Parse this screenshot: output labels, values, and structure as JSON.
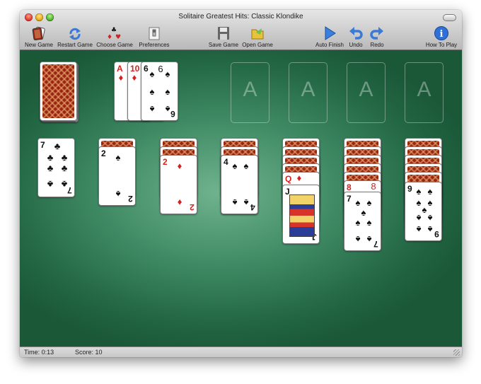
{
  "window": {
    "title": "Solitaire Greatest Hits: Classic Klondike"
  },
  "toolbar": {
    "new_game": "New Game",
    "restart_game": "Restart Game",
    "choose_game": "Choose Game",
    "preferences": "Preferences",
    "save_game": "Save Game",
    "open_game": "Open Game",
    "auto_finish": "Auto Finish",
    "undo": "Undo",
    "redo": "Redo",
    "how_to_play": "How To Play"
  },
  "foundations": {
    "labels": [
      "A",
      "A",
      "A",
      "A"
    ]
  },
  "waste": {
    "cards": [
      {
        "rank": "A",
        "suit": "♦",
        "color": "red"
      },
      {
        "rank": "10",
        "suit": "♦",
        "color": "red"
      },
      {
        "rank": "6",
        "suit": "♠",
        "color": "black"
      }
    ]
  },
  "tableau": {
    "col1": {
      "hidden": 0,
      "top": {
        "rank": "7",
        "suit": "♣",
        "color": "black"
      }
    },
    "col2": {
      "hidden": 1,
      "top": {
        "rank": "2",
        "suit": "♠",
        "color": "black"
      }
    },
    "col3": {
      "hidden": 2,
      "top": {
        "rank": "2",
        "suit": "♦",
        "color": "red"
      }
    },
    "col4": {
      "hidden": 3,
      "top": {
        "rank": "4",
        "suit": "♠",
        "color": "black"
      }
    },
    "col5": {
      "hidden": 4,
      "under": {
        "rank": "Q",
        "suit": "♦",
        "color": "red"
      },
      "top": {
        "rank": "J",
        "suit": "♠",
        "color": "black"
      }
    },
    "col6": {
      "hidden": 5,
      "under": {
        "rank": "8",
        "suit": "♦",
        "color": "red"
      },
      "top": {
        "rank": "7",
        "suit": "♠",
        "color": "black"
      }
    },
    "col7": {
      "hidden": 5,
      "top": {
        "rank": "9",
        "suit": "♠",
        "color": "black"
      }
    }
  },
  "status": {
    "time": "Time: 0:13",
    "score": "Score: 10"
  },
  "colors": {
    "felt": "#3f8a64",
    "red_suit": "#d71f1f",
    "card_back": "#9a2414",
    "info_blue": "#2f6fd6"
  }
}
